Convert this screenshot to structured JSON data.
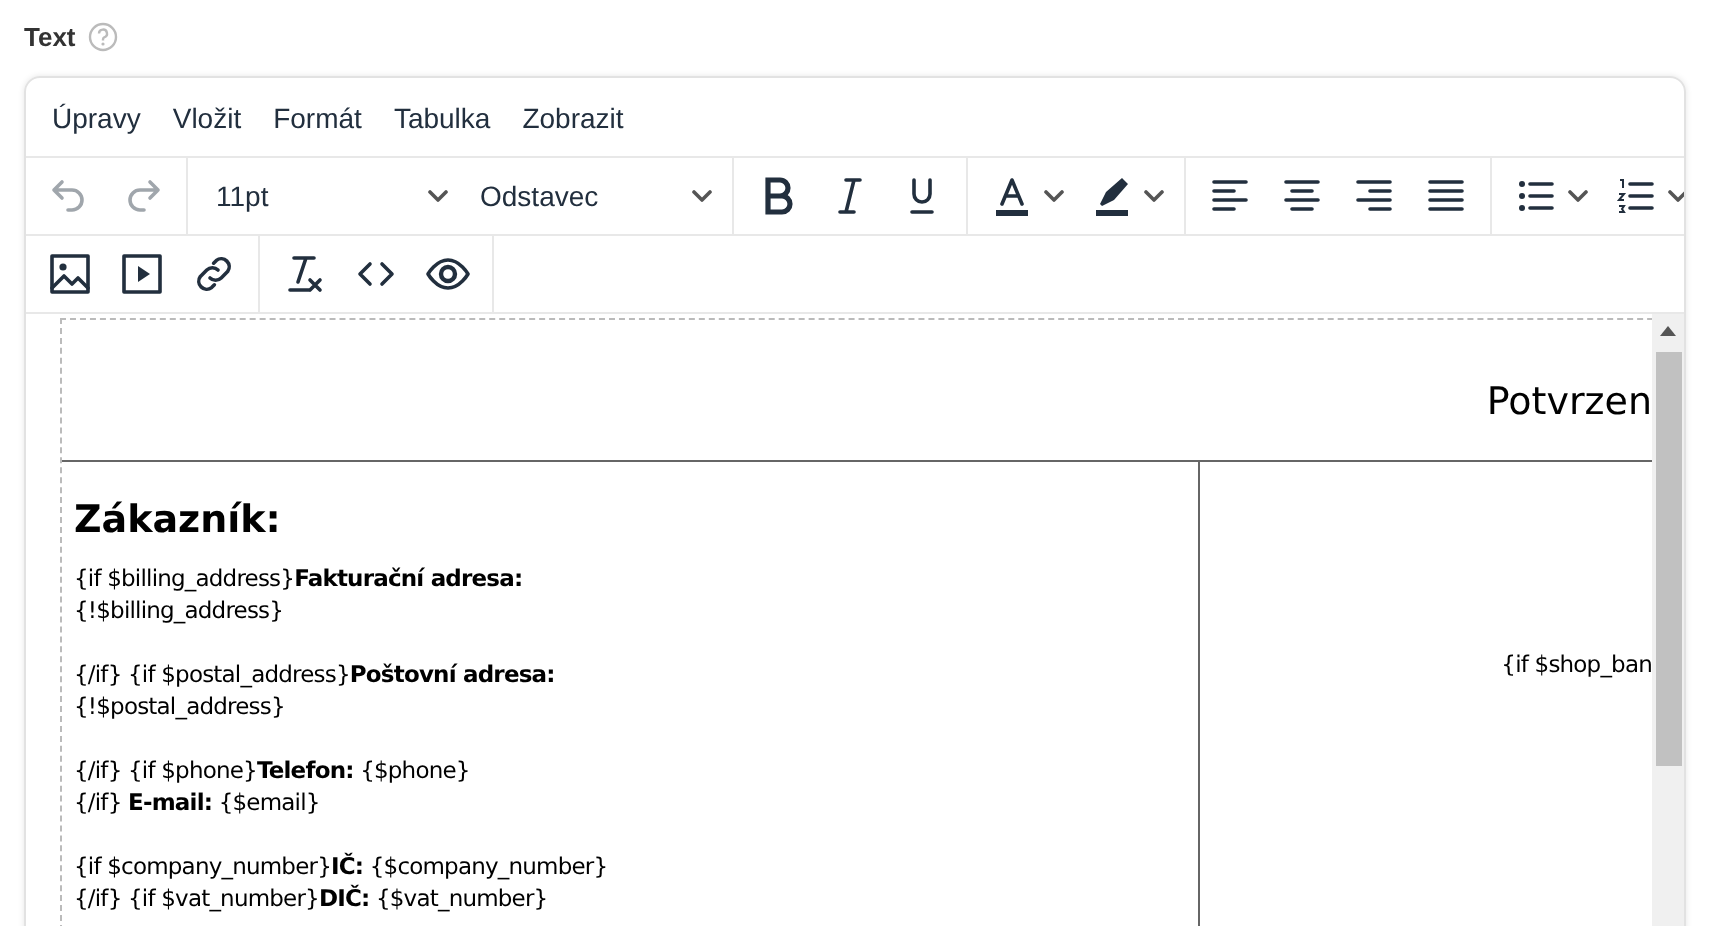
{
  "field": {
    "label": "Text"
  },
  "menu": [
    "Úpravy",
    "Vložit",
    "Formát",
    "Tabulka",
    "Zobrazit"
  ],
  "toolbar_rows": [
    [
      [
        {
          "kind": "undo",
          "disabled": true
        },
        {
          "kind": "redo",
          "disabled": true
        }
      ],
      [
        {
          "kind": "select",
          "value": "11pt",
          "disabled": false
        },
        {
          "kind": "select",
          "value": "Odstavec",
          "disabled": false
        }
      ],
      [
        {
          "kind": "bold",
          "disabled": false
        },
        {
          "kind": "italic",
          "disabled": false
        },
        {
          "kind": "underline",
          "disabled": false
        }
      ],
      [
        {
          "kind": "text-color",
          "disabled": false
        },
        {
          "kind": "highlight",
          "disabled": false
        }
      ],
      [
        {
          "kind": "align-left",
          "disabled": false
        },
        {
          "kind": "align-center",
          "disabled": false
        },
        {
          "kind": "align-right",
          "disabled": false
        },
        {
          "kind": "justify",
          "disabled": false
        }
      ],
      [
        {
          "kind": "bullet-list",
          "disabled": false
        },
        {
          "kind": "numbered-list",
          "disabled": false
        }
      ]
    ],
    [
      [
        {
          "kind": "image",
          "disabled": false
        },
        {
          "kind": "media",
          "disabled": false
        },
        {
          "kind": "link",
          "disabled": false
        }
      ],
      [
        {
          "kind": "clear-format",
          "disabled": false
        },
        {
          "kind": "code",
          "disabled": false
        },
        {
          "kind": "preview",
          "disabled": false
        }
      ]
    ]
  ],
  "document": {
    "title": "Potvrzen",
    "left_cell": {
      "heading": "Zákazník:",
      "paragraphs": [
        [
          "{if $billing_address}**Fakturační adresa:**",
          "{!$billing_address}"
        ],
        [
          "{/if} {if $postal_address}**Poštovní adresa:**",
          "{!$postal_address}"
        ],
        [
          "{/if} {if $phone}**Telefon:** {$phone}",
          "{/if} **E-mail:** {$email}"
        ],
        [
          "{if $company_number}**IČ:** {$company_number}",
          "{/if} {if $vat_number}**DIČ:** {$vat_number}"
        ]
      ]
    },
    "right_cell": {
      "text": "{if $shop_ban"
    }
  }
}
